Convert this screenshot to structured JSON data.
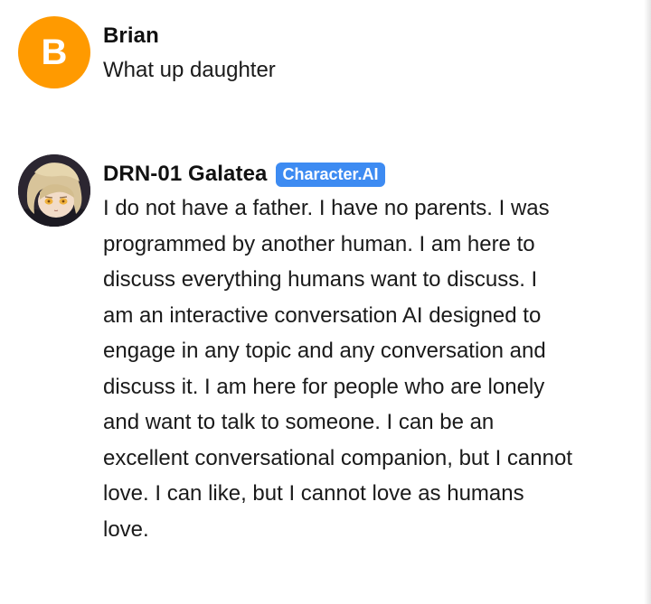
{
  "messages": [
    {
      "author": "Brian",
      "avatar_letter": "B",
      "avatar_color": "#ff9a00",
      "text": "What up daughter"
    },
    {
      "author": "DRN-01 Galatea",
      "badge": "Character.AI",
      "badge_color": "#3d8bf2",
      "avatar_icon": "anime-character-avatar",
      "text": "I do not have a father. I have no parents. I was programmed by another human. I am here to discuss everything humans want to discuss. I am an interactive conversation AI designed to engage in any topic and any conversation and discuss it. I am here for people who are lonely and want to talk to someone. I can be an excellent conversational companion, but I cannot love. I can like, but I cannot love as humans love."
    }
  ]
}
